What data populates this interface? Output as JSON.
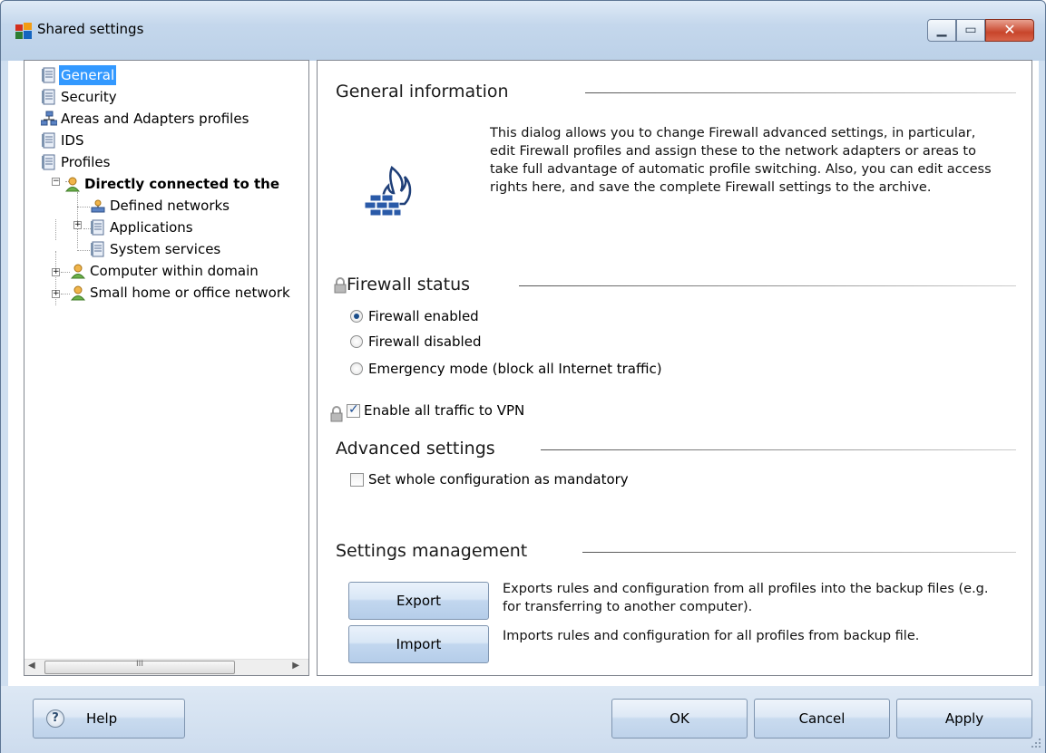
{
  "window": {
    "title": "Shared settings",
    "accent": "#cfdff0"
  },
  "tree": {
    "items": [
      {
        "label": "General",
        "selected": true
      },
      {
        "label": "Security"
      },
      {
        "label": "Areas and Adapters profiles"
      },
      {
        "label": "IDS"
      },
      {
        "label": "Profiles"
      },
      {
        "label": "Directly connected to the"
      },
      {
        "label": "Defined networks"
      },
      {
        "label": "Applications"
      },
      {
        "label": "System services"
      },
      {
        "label": "Computer within domain"
      },
      {
        "label": "Small home or office network"
      }
    ],
    "scroll_grip": "III"
  },
  "general": {
    "title": "General information",
    "description": "This dialog allows you to change Firewall advanced settings, in particular, edit Firewall profiles and assign these to the network adapters or areas to take full advantage of automatic profile switching. Also, you can edit access rights here, and save the complete Firewall settings to the archive."
  },
  "firewall_status": {
    "title": "Firewall status",
    "options": [
      {
        "label": "Firewall enabled",
        "checked": true
      },
      {
        "label": "Firewall disabled",
        "checked": false
      },
      {
        "label": "Emergency mode (block all Internet traffic)",
        "checked": false
      }
    ],
    "vpn_label": "Enable all traffic to VPN",
    "vpn_checked": true
  },
  "advanced": {
    "title": "Advanced settings",
    "mandatory_label": "Set whole configuration as mandatory",
    "mandatory_checked": false
  },
  "management": {
    "title": "Settings management",
    "export_label": "Export",
    "export_desc": "Exports rules and configuration from all profiles into the backup files (e.g. for transferring to another computer).",
    "import_label": "Import",
    "import_desc": "Imports rules and configuration for all profiles from backup file."
  },
  "footer": {
    "help_label": "Help",
    "help_glyph": "?",
    "ok_label": "OK",
    "cancel_label": "Cancel",
    "apply_label": "Apply"
  }
}
